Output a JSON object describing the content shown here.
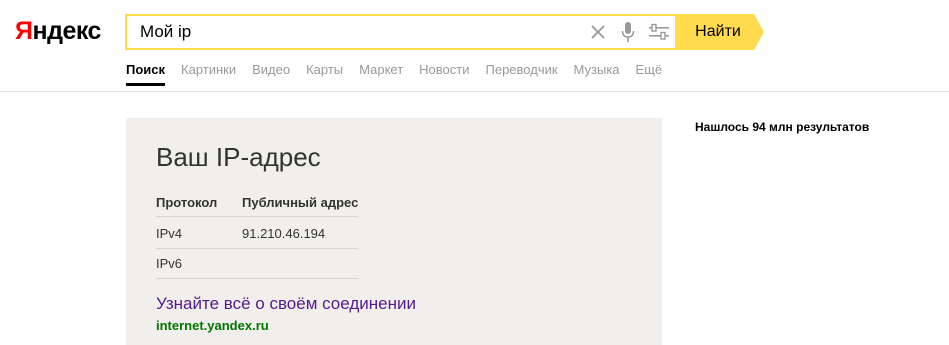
{
  "logo": {
    "first": "Я",
    "rest": "ндекс"
  },
  "search": {
    "query": "Мой ip",
    "find_label": "Найти",
    "icons": {
      "clear": "close-icon",
      "mic": "microphone-icon",
      "settings": "settings-sliders-icon"
    }
  },
  "tabs": [
    "Поиск",
    "Картинки",
    "Видео",
    "Карты",
    "Маркет",
    "Новости",
    "Переводчик",
    "Музыка",
    "Ещё"
  ],
  "active_tab": "Поиск",
  "ip_card": {
    "title": "Ваш IP-адрес",
    "headers": {
      "protocol": "Протокол",
      "address": "Публичный адрес"
    },
    "rows": [
      {
        "protocol": "IPv4",
        "address": "91.210.46.194"
      },
      {
        "protocol": "IPv6",
        "address": ""
      }
    ],
    "link_text": "Узнайте всё о своём соединении",
    "link_url": "internet.yandex.ru"
  },
  "results_count": "Нашлось 94 млн результатов",
  "colors": {
    "accent": "#ffdb4d",
    "logo_red": "#ff0000",
    "link_purple": "#551a8b",
    "url_green": "#007700",
    "card_bg": "#f0efeb"
  }
}
